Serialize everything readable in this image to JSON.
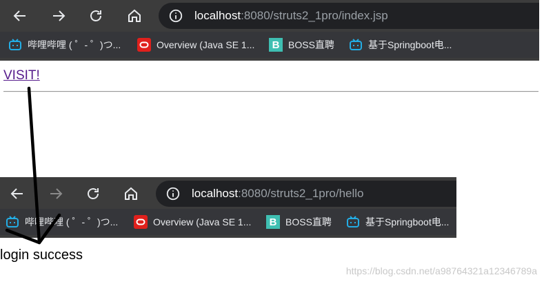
{
  "top_browser": {
    "url_host": "localhost",
    "url_rest": ":8080/struts2_1pro/index.jsp",
    "bookmarks": [
      {
        "label": "哔哩哔哩 ( ゜- ゜)つ...",
        "icon": "bilibili-icon"
      },
      {
        "label": "Overview (Java SE 1...",
        "icon": "oracle-icon"
      },
      {
        "label": "BOSS直聘",
        "icon": "boss-icon"
      },
      {
        "label": "基于Springboot电...",
        "icon": "bilibili-icon"
      }
    ]
  },
  "page_top": {
    "link": "VISIT!"
  },
  "bottom_browser": {
    "url_host": "localhost",
    "url_rest": ":8080/struts2_1pro/hello",
    "bookmarks": [
      {
        "label": "哔哩哔哩 ( ゜- ゜)つ...",
        "icon": "bilibili-icon"
      },
      {
        "label": "Overview (Java SE 1...",
        "icon": "oracle-icon"
      },
      {
        "label": "BOSS直聘",
        "icon": "boss-icon"
      },
      {
        "label": "基于Springboot电...",
        "icon": "bilibili-icon"
      }
    ]
  },
  "page_bottom": {
    "message": "login success"
  },
  "watermark": "https://blog.csdn.net/a98764321a12346789a",
  "colors": {
    "toolbar": "#3c3c3c",
    "bookmarks_bar": "#35363a",
    "omnibox": "#202124",
    "bilibili": "#23ade5",
    "oracle": "#e0201c",
    "boss": "#3fbfb2",
    "link": "#551a8b"
  }
}
